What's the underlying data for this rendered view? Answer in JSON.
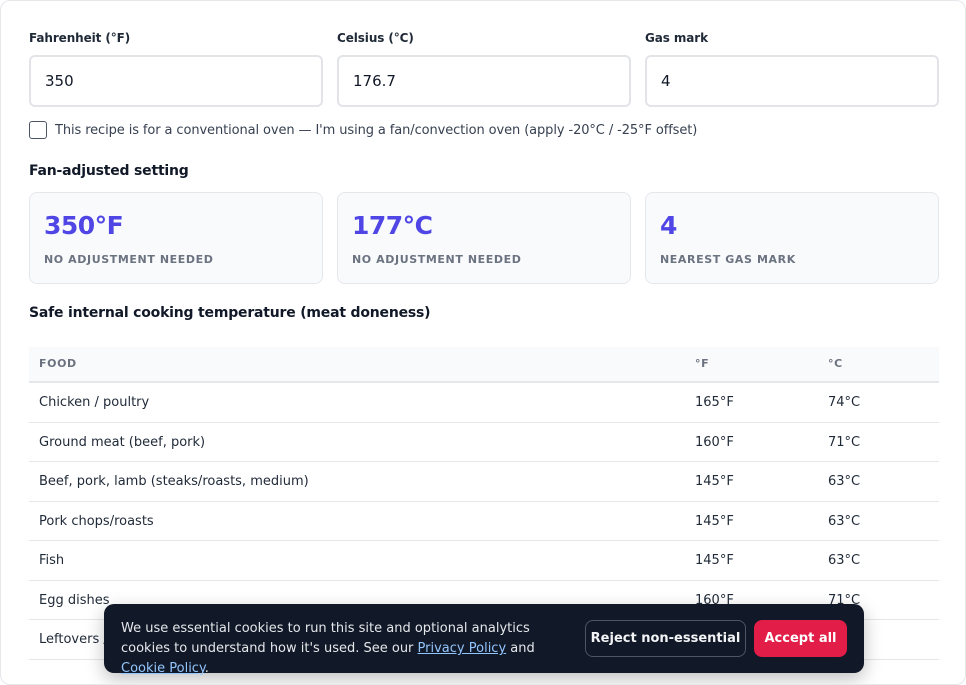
{
  "converter": {
    "fahrenheit": {
      "label": "Fahrenheit (°F)",
      "value": "350"
    },
    "celsius": {
      "label": "Celsius (°C)",
      "value": "176.7"
    },
    "gas_mark": {
      "label": "Gas mark",
      "value": "4"
    },
    "fan_checkbox": {
      "checked": false,
      "label": "This recipe is for a conventional oven — I'm using a fan/convection oven (apply -20°C / -25°F offset)"
    }
  },
  "fan_adjusted": {
    "title": "Fan-adjusted setting",
    "cards": [
      {
        "value": "350°F",
        "caption": "NO ADJUSTMENT NEEDED"
      },
      {
        "value": "177°C",
        "caption": "NO ADJUSTMENT NEEDED"
      },
      {
        "value": "4",
        "caption": "NEAREST GAS MARK"
      }
    ]
  },
  "doneness": {
    "title": "Safe internal cooking temperature (meat doneness)",
    "headers": {
      "food": "FOOD",
      "f": "°F",
      "c": "°C"
    },
    "rows": [
      {
        "food": "Chicken / poultry",
        "f": "165°F",
        "c": "74°C"
      },
      {
        "food": "Ground meat (beef, pork)",
        "f": "160°F",
        "c": "71°C"
      },
      {
        "food": "Beef, pork, lamb (steaks/roasts, medium)",
        "f": "145°F",
        "c": "63°C"
      },
      {
        "food": "Pork chops/roasts",
        "f": "145°F",
        "c": "63°C"
      },
      {
        "food": "Fish",
        "f": "145°F",
        "c": "63°C"
      },
      {
        "food": "Egg dishes",
        "f": "160°F",
        "c": "71°C"
      },
      {
        "food": "Leftovers /",
        "f": "",
        "c": ""
      }
    ]
  },
  "cookie_banner": {
    "text_before": "We use essential cookies to run this site and optional analytics cookies to understand how it's used. See our ",
    "privacy_link": "Privacy Policy",
    "text_middle": " and ",
    "cookie_link": "Cookie Policy",
    "text_after": ".",
    "reject_label": "Reject non-essential",
    "accept_label": "Accept all"
  },
  "colors": {
    "accent": "#4f46e5",
    "accept_button": "#e11d48",
    "banner_bg": "#111827"
  }
}
